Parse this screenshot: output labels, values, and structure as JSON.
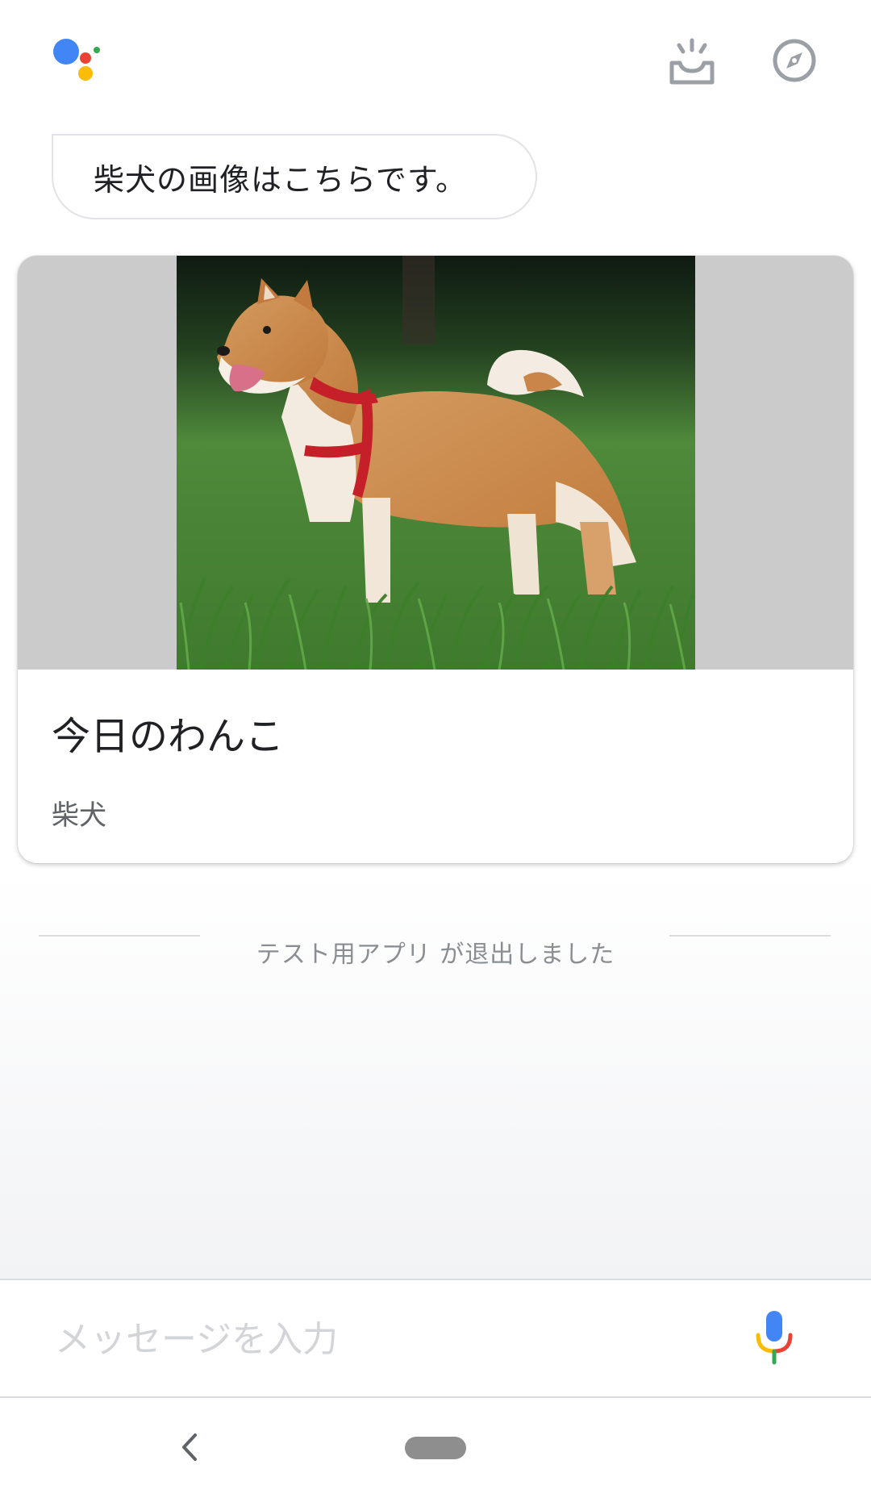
{
  "header": {
    "logo_icon": "google-assistant-logo",
    "updates_icon": "updates-inbox-icon",
    "explore_icon": "explore-compass-icon"
  },
  "conversation": {
    "assistant_message": "柴犬の画像はこちらです。",
    "card": {
      "image_subject": "shiba-inu-dog-photo",
      "title": "今日のわんこ",
      "subtitle": "柴犬"
    },
    "exit_notice": "テスト用アプリ が退出しました"
  },
  "input": {
    "placeholder": "メッセージを入力",
    "value": "",
    "mic_icon": "microphone-icon"
  },
  "nav": {
    "back_icon": "back-chevron-icon",
    "home_icon": "home-pill-icon"
  },
  "colors": {
    "google_blue": "#4285F4",
    "google_red": "#EA4335",
    "google_yellow": "#FBBC05",
    "google_green": "#34A853",
    "icon_gray": "#9AA0A6"
  }
}
